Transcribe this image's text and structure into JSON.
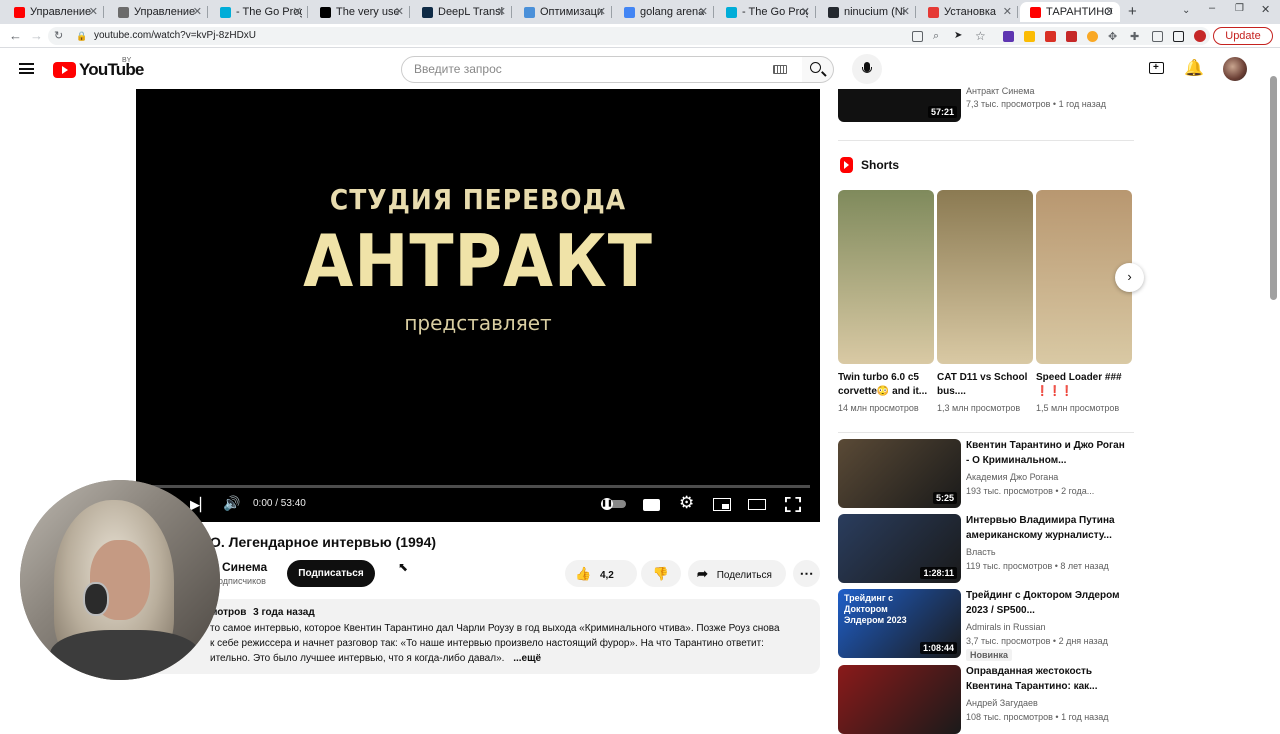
{
  "browser": {
    "tabs": [
      {
        "label": "Управление",
        "favicon_color": "#ff0000"
      },
      {
        "label": "Управление",
        "favicon_color": "#6b6b6b"
      },
      {
        "label": "- The Go Prog",
        "favicon_color": "#00add8"
      },
      {
        "label": "The very use",
        "favicon_color": "#000000"
      },
      {
        "label": "DeepL Transl",
        "favicon_color": "#0f2b46"
      },
      {
        "label": "Оптимизаци",
        "favicon_color": "#4a90d9"
      },
      {
        "label": "golang arena",
        "favicon_color": "#4285f4"
      },
      {
        "label": "- The Go Prog",
        "favicon_color": "#00add8"
      },
      {
        "label": "ninucium (Ni",
        "favicon_color": "#24292f"
      },
      {
        "label": "Установка",
        "favicon_color": "#e53935"
      },
      {
        "label": "ТАРАНТИНО",
        "favicon_color": "#ff0000",
        "active": true
      }
    ],
    "url": "youtube.com/watch?v=kvPj-8zHDxU",
    "update_label": "Update"
  },
  "header": {
    "logo_text": "YouTube",
    "region": "BY",
    "search_placeholder": "Введите запрос"
  },
  "player": {
    "studio_line": "СТУДИЯ ПЕРЕВОДА",
    "studio_name": "АНТРАКТ",
    "presents": "представляет",
    "time": "0:00 / 53:40",
    "progress": 0
  },
  "video": {
    "title": "О. Легендарное интервью (1994)",
    "channel": "Синема",
    "subscribers": "одписчиков",
    "subscribe_label": "Подписаться",
    "likes": "4,2 тыс.",
    "share_label": "Поделиться",
    "views_part": "мотров",
    "date": "3 года назад",
    "description_lines": [
      "то самое интервью, которое Квентин Тарантино дал Чарли Роузу в год выхода «Криминального чтива». Позже Роуз снова",
      "к себе режиссера и начнет разговор так: «То наше интервью произвело настоящий фурор». На что Тарантино ответит:",
      "ительно. Это было лучшее интервью, что я когда-либо давал»."
    ],
    "more_label": "...ещё"
  },
  "sidebar": {
    "top_video": {
      "channel": "Антракт Синема",
      "views": "7,3 тыс. просмотров",
      "date": "1 год назад",
      "duration": "57:21"
    },
    "shorts_heading": "Shorts",
    "shorts": [
      {
        "title": "Twin turbo 6.0 c5 corvette😳 and it...",
        "views": "14 млн просмотров",
        "thumb_color": "#7f8a5c"
      },
      {
        "title": "CAT D11 vs School bus....",
        "views": "1,3 млн просмотров",
        "thumb_color": "#8b7a52"
      },
      {
        "title": "Speed Loader ### ❗❗❗",
        "views": "1,5 млн просмотров",
        "thumb_color": "#b89770"
      }
    ],
    "videos": [
      {
        "title": "Квентин Тарантино и Джо Роган - О Криминальном...",
        "channel": "Академия Джо Рогана",
        "views": "193 тыс. просмотров",
        "date": "2 года...",
        "duration": "5:25",
        "thumb_color": "#5a4a36"
      },
      {
        "title": "Интервью Владимира Путина американскому журналисту...",
        "channel": "Власть",
        "views": "119 тыс. просмотров",
        "date": "8 лет назад",
        "duration": "1:28:11",
        "thumb_color": "#2a3d5e"
      },
      {
        "title": "Трейдинг с Доктором Элдером 2023 / SP500...",
        "channel": "Admirals in Russian",
        "views": "3,7 тыс. просмотров",
        "date": "2 дня назад",
        "duration": "1:08:44",
        "badge": "Новинка",
        "thumb_color": "#1f5fc9",
        "thumb_text": "Трейдинг с Доктором Элдером 2023"
      },
      {
        "title": "Оправданная жестокость Квентина Тарантино: как...",
        "channel": "Андрей Загудаев",
        "views": "108 тыс. просмотров",
        "date": "1 год назад",
        "thumb_color": "#8a1a1a"
      }
    ]
  }
}
